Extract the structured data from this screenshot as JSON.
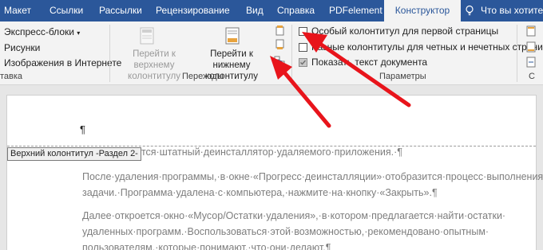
{
  "tabs": [
    {
      "label": "Макет"
    },
    {
      "label": "Ссылки"
    },
    {
      "label": "Рассылки"
    },
    {
      "label": "Рецензирование"
    },
    {
      "label": "Вид"
    },
    {
      "label": "Справка"
    },
    {
      "label": "PDFelement"
    },
    {
      "label": "Конструктор"
    },
    {
      "label": "Что вы хотите сд"
    }
  ],
  "ribbon": {
    "insert": {
      "express_blocks": "Экспресс-блоки",
      "pictures": "Рисунки",
      "online_pictures": "Изображения в Интернете",
      "group_label": "тавка"
    },
    "navigation": {
      "goto_header": "Перейти к верхнему колонтитулу",
      "goto_header_l1": "Перейти к верхнему",
      "goto_header_l2": "колонтитулу",
      "goto_footer_l1": "Перейти к нижнему",
      "goto_footer_l2": "колонтитулу",
      "group_label": "Переходы"
    },
    "options": {
      "first_page": "Особый колонтитул для первой страницы",
      "first_page_checked": false,
      "odd_even": "Разные колонтитулы для четных и нечетных страниц",
      "odd_even_checked": false,
      "show_text": "Показать текст документа",
      "show_text_checked": true,
      "group_label": "Параметры"
    },
    "position_group_label": "С"
  },
  "document": {
    "header_tag": "Верхний колонтитул -Раздел 2-",
    "cursor_mark": "¶",
    "lines": [
      "стится·штатный·деинсталлятор·удаляемого·приложения.·¶",
      "После·удаления·программы,·в·окне·«Прогресс·деинсталляции»·отобразится·процесс·выполнения·",
      "задачи.·Программа·удалена·с·компьютера,·нажмите·на·кнопку·«Закрыть».¶",
      "Далее·откроется·окно·«Мусор/Остатки·удаления»,·в·котором·предлагается·найти·остатки·",
      "удаленных·программ.·Воспользоваться·этой·возможностью,·рекомендовано·опытным·",
      "пользователям,·которые·понимают,·что·они·делают.¶"
    ]
  },
  "colors": {
    "tabbar": "#2b579a",
    "ribbon": "#f3f3f3",
    "arrow": "#e8141b"
  }
}
